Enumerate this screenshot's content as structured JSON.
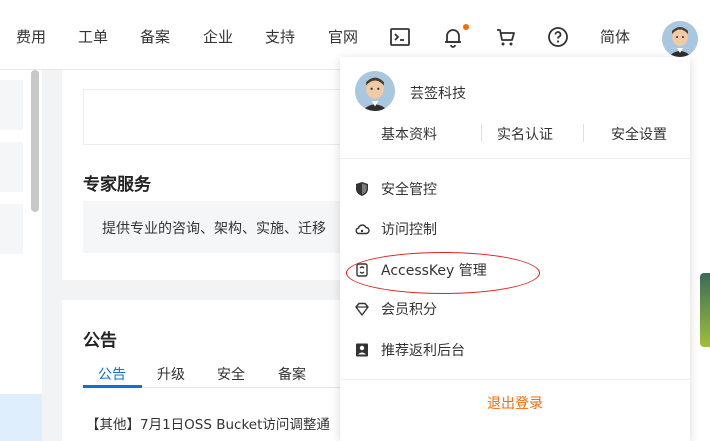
{
  "topnav": {
    "items": [
      "费用",
      "工单",
      "备案",
      "企业",
      "支持",
      "官网"
    ],
    "icons": [
      "terminal-icon",
      "bell-icon",
      "cart-icon",
      "help-icon"
    ],
    "language": "简体",
    "notify_color": "#ff6a00"
  },
  "main": {
    "expert_title": "专家服务",
    "expert_desc": "提供专业的咨询、架构、实施、迁移",
    "notice_title": "公告",
    "notice_tabs": [
      "公告",
      "升级",
      "安全",
      "备案"
    ],
    "active_tab": "公告",
    "notice_item": "【其他】7月1日OSS Bucket访问调整通"
  },
  "dropdown": {
    "username": "芸签科技",
    "links": [
      "基本资料",
      "实名认证",
      "安全设置"
    ],
    "menu": [
      {
        "label": "安全管控",
        "icon": "shield-icon"
      },
      {
        "label": "访问控制",
        "icon": "cloud-icon"
      },
      {
        "label": "AccessKey 管理",
        "icon": "key-icon"
      },
      {
        "label": "会员积分",
        "icon": "diamond-icon"
      },
      {
        "label": "推荐返利后台",
        "icon": "user-card-icon"
      }
    ],
    "logout": "退出登录",
    "highlight_color": "#e02020"
  },
  "colors": {
    "accent": "#1170d6",
    "orange": "#ff6a00"
  }
}
